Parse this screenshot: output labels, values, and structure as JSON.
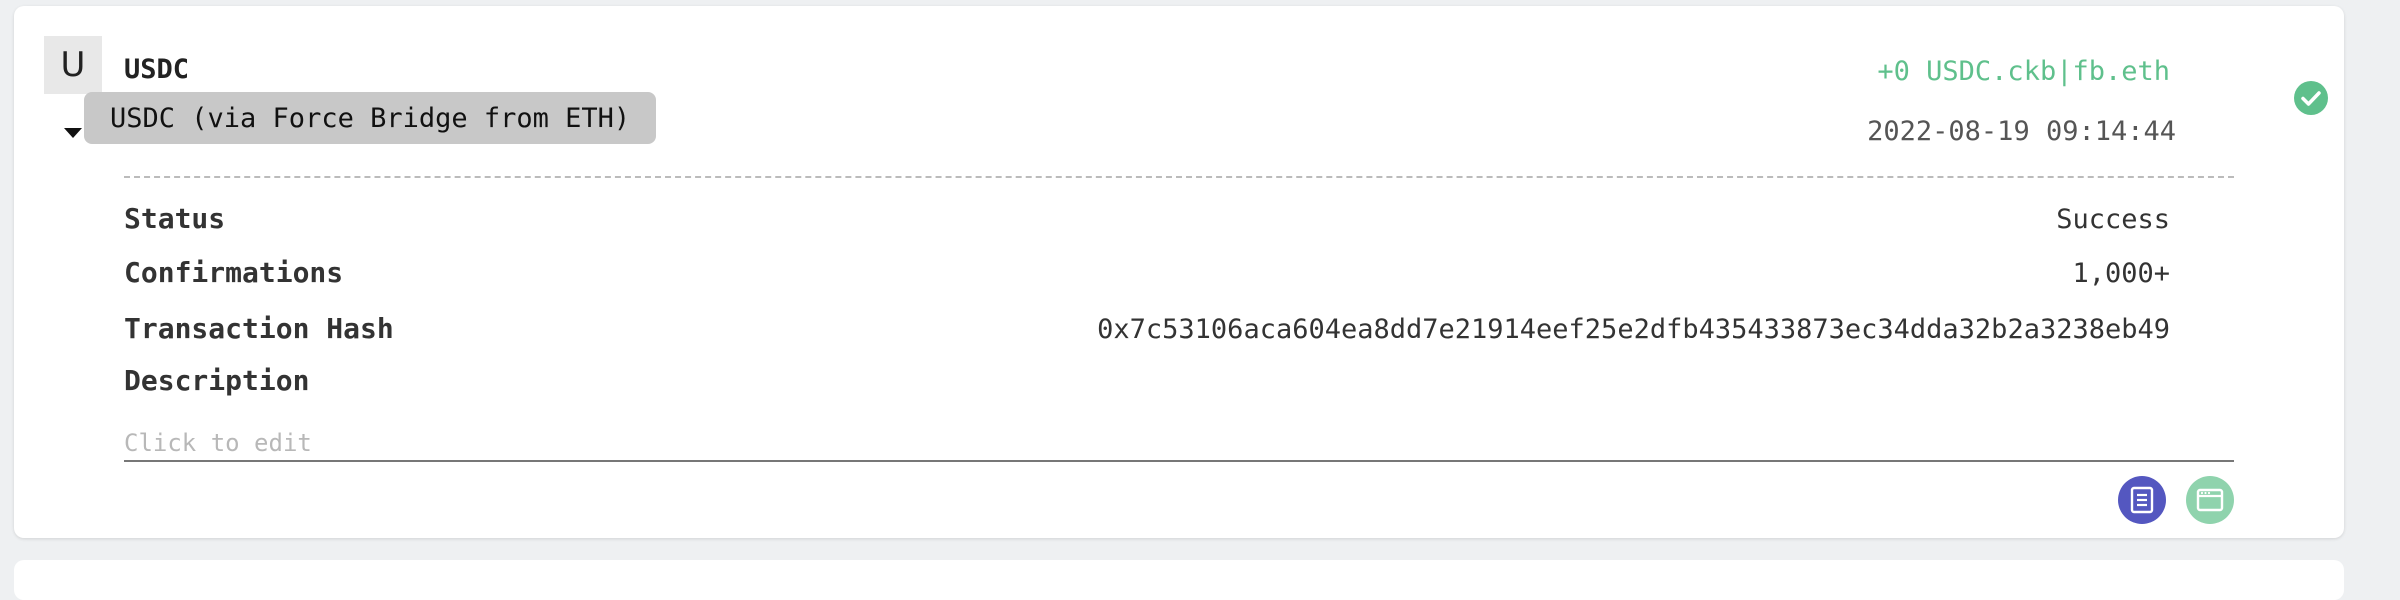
{
  "transaction": {
    "avatar_letter": "U",
    "symbol": "USDC",
    "tooltip": "USDC (via Force Bridge from ETH)",
    "amount": "+0 USDC.ckb|fb.eth",
    "timestamp": "2022-08-19 09:14:44",
    "status_icon": "check-circle-icon"
  },
  "details": {
    "status_label": "Status",
    "status_value": "Success",
    "confirmations_label": "Confirmations",
    "confirmations_value": "1,000+",
    "hash_label": "Transaction Hash",
    "hash_value": "0x7c53106aca604ea8dd7e21914eef25e2dfb435433873ec34dda32b2a3238eb49",
    "description_label": "Description",
    "description_value": "",
    "description_placeholder": "Click to edit"
  },
  "actions": [
    {
      "icon": "document-icon",
      "color": "#5457c0"
    },
    {
      "icon": "browser-window-icon",
      "color": "#8fd3ad"
    }
  ],
  "colors": {
    "amount": "#5fc08c",
    "success": "#5fc08c"
  }
}
